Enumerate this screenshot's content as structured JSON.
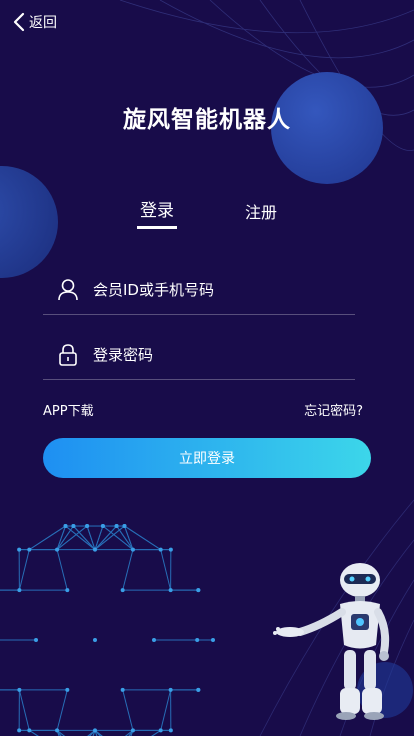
{
  "nav": {
    "back_label": "返回"
  },
  "app": {
    "title": "旋风智能机器人"
  },
  "tabs": {
    "login": "登录",
    "register": "注册",
    "active": "login"
  },
  "form": {
    "username_placeholder": "会员ID或手机号码",
    "password_placeholder": "登录密码",
    "username_value": "",
    "password_value": ""
  },
  "links": {
    "app_download": "APP下载",
    "forgot_password": "忘记密码?"
  },
  "login_button": "立即登录",
  "colors": {
    "background": "#180c4a",
    "circle": "#2c4eb0",
    "button_gradient_start": "#1e8ff2",
    "button_gradient_end": "#3cd6ea",
    "network": "#2a7fc9"
  },
  "icons": {
    "back": "chevron-left-icon",
    "user": "user-icon",
    "lock": "lock-icon"
  }
}
